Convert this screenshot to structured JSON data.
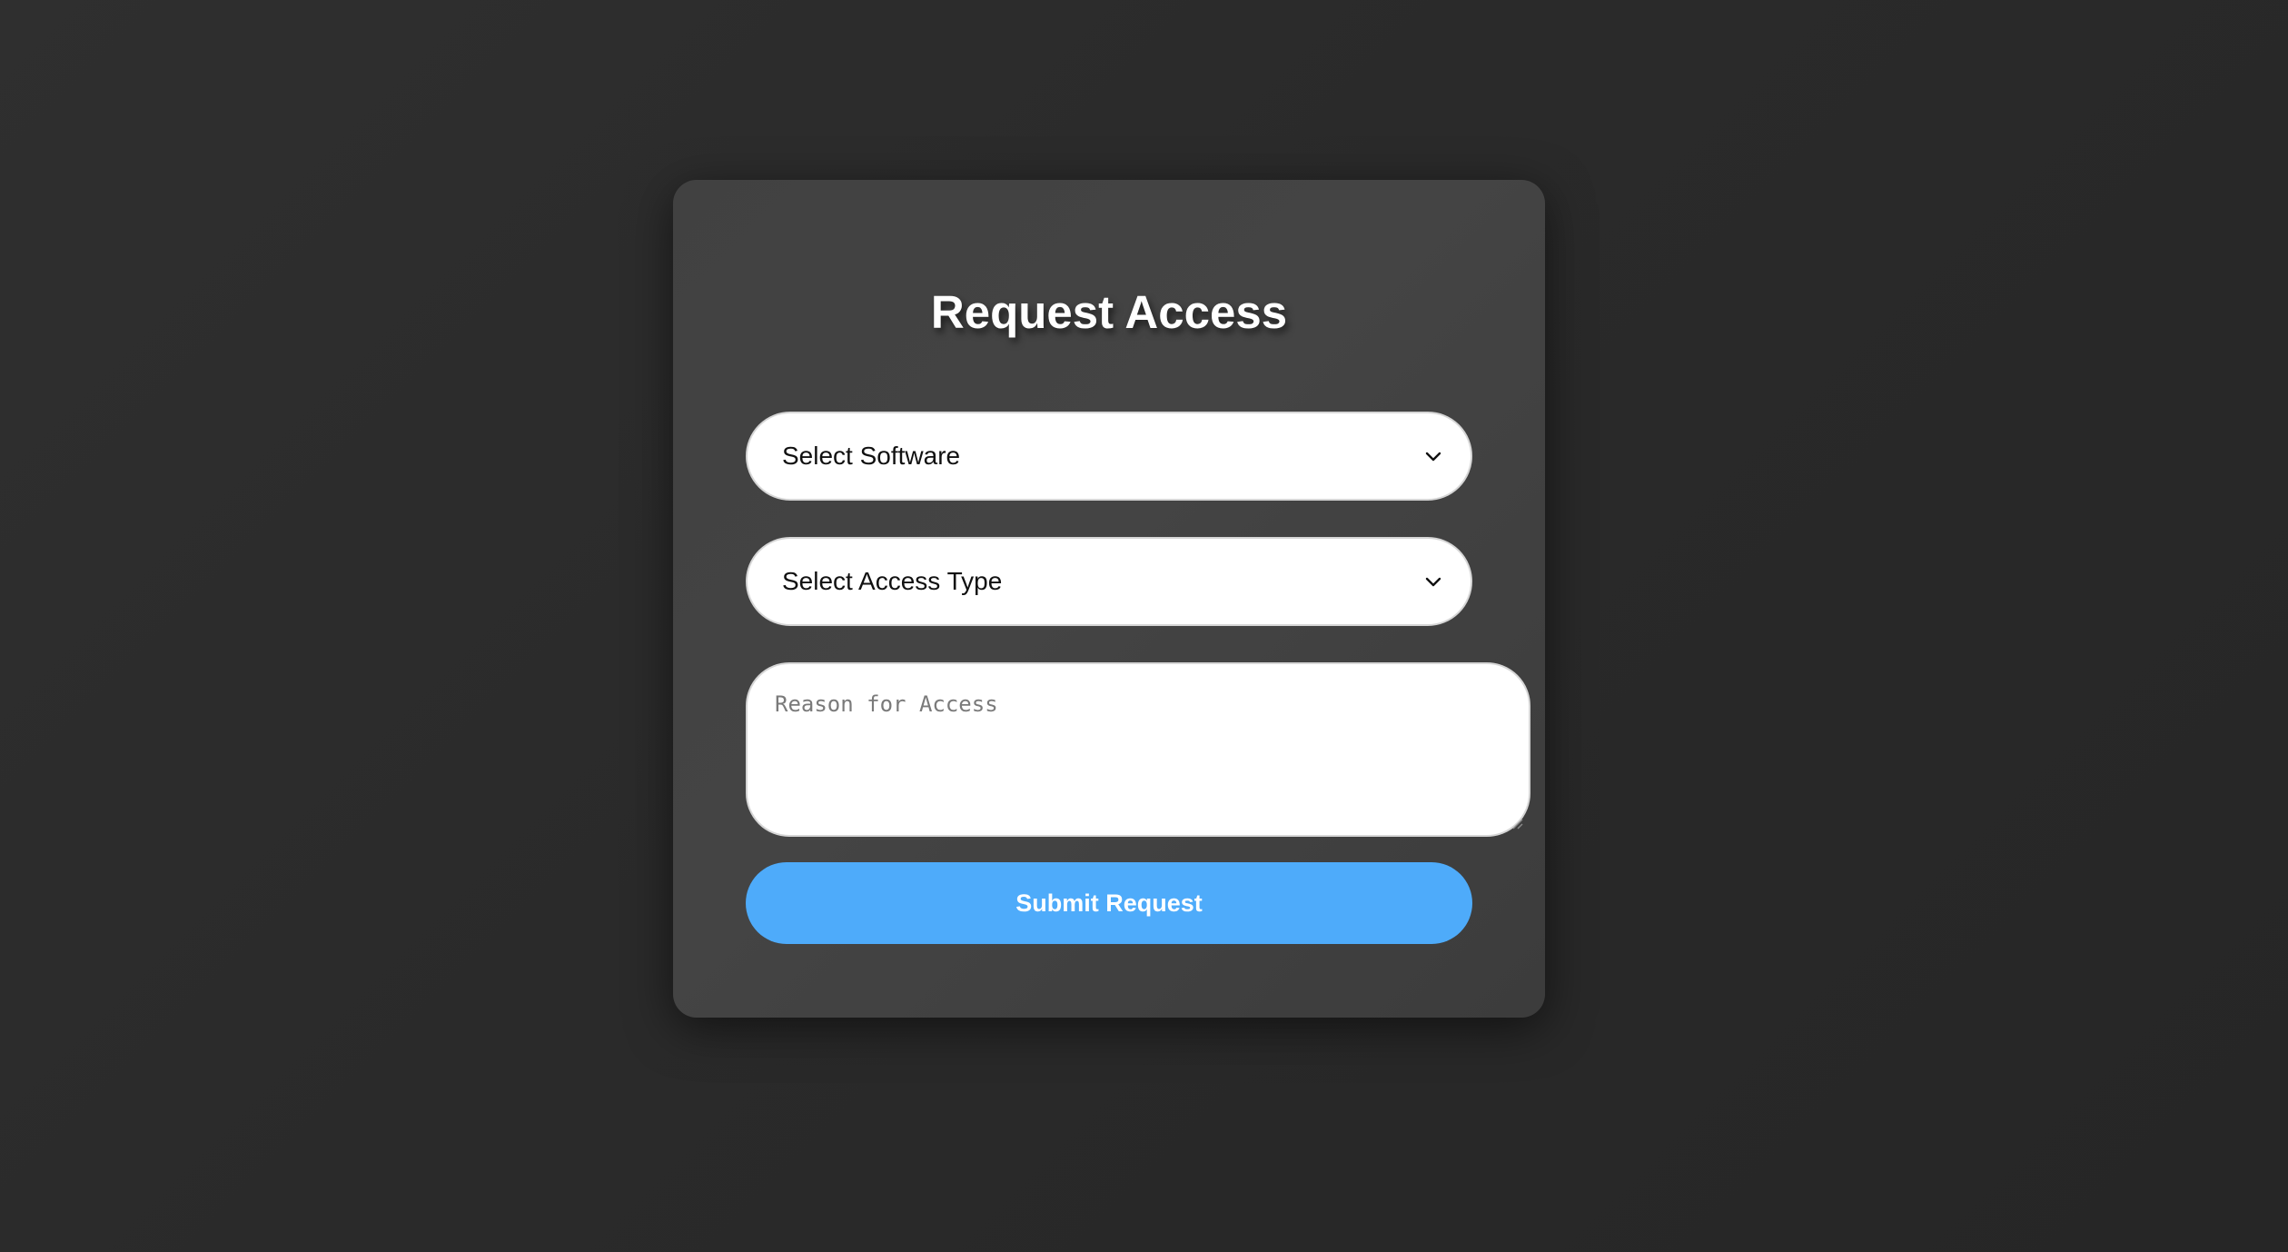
{
  "form": {
    "title": "Request Access",
    "software_select": {
      "selected": "Select Software",
      "icon": "chevron-down-icon"
    },
    "access_type_select": {
      "selected": "Select Access Type",
      "icon": "chevron-down-icon"
    },
    "reason_field": {
      "value": "",
      "placeholder": "Reason for Access"
    },
    "submit_label": "Submit Request"
  },
  "colors": {
    "background": "#2b2b2b",
    "card": "#424242",
    "accent": "#4eabfa",
    "title": "#ffffff"
  }
}
